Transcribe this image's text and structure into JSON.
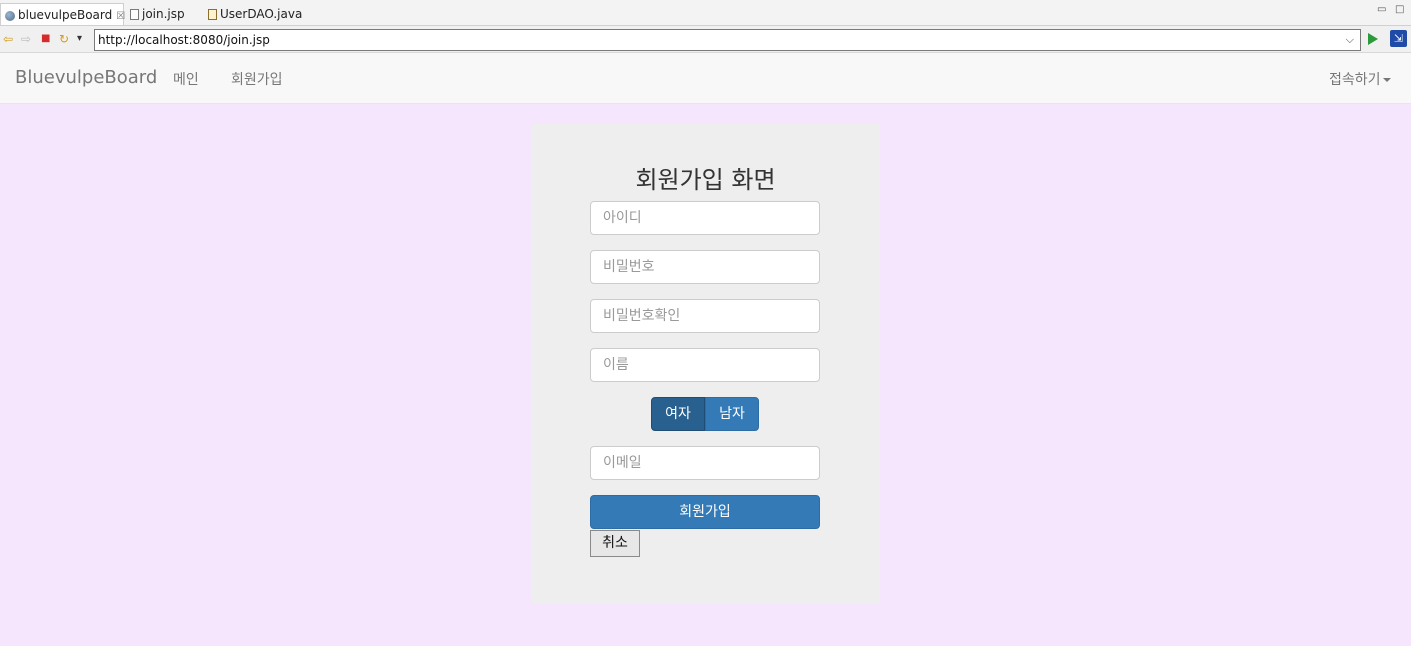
{
  "ide": {
    "tabs": [
      {
        "label": "bluevulpeBoard",
        "close": "☒"
      },
      {
        "label": "join.jsp"
      },
      {
        "label": "UserDAO.java"
      }
    ],
    "window_controls": [
      "▭",
      "□"
    ]
  },
  "browser": {
    "url": "http://localhost:8080/join.jsp",
    "url_dropdown": "⌵",
    "buttons": {
      "back": "⇦",
      "forward": "⇨",
      "stop": "■",
      "refresh": "↻",
      "menu": "▾",
      "external": "⇲"
    }
  },
  "navbar": {
    "brand": "BluevulpeBoard",
    "links": [
      "메인",
      "회원가입"
    ],
    "dropdown": "접속하기"
  },
  "form": {
    "title": "회원가입 화면",
    "placeholders": {
      "id": "아이디",
      "password": "비밀번호",
      "password_confirm": "비밀번호확인",
      "name": "이름",
      "email": "이메일"
    },
    "gender": {
      "female": "여자",
      "male": "남자",
      "selected": "female"
    },
    "submit_label": "회원가입",
    "cancel_label": "취소"
  },
  "colors": {
    "page_background": "#f6e6fd",
    "primary": "#337ab7",
    "primary_active": "#286090"
  }
}
